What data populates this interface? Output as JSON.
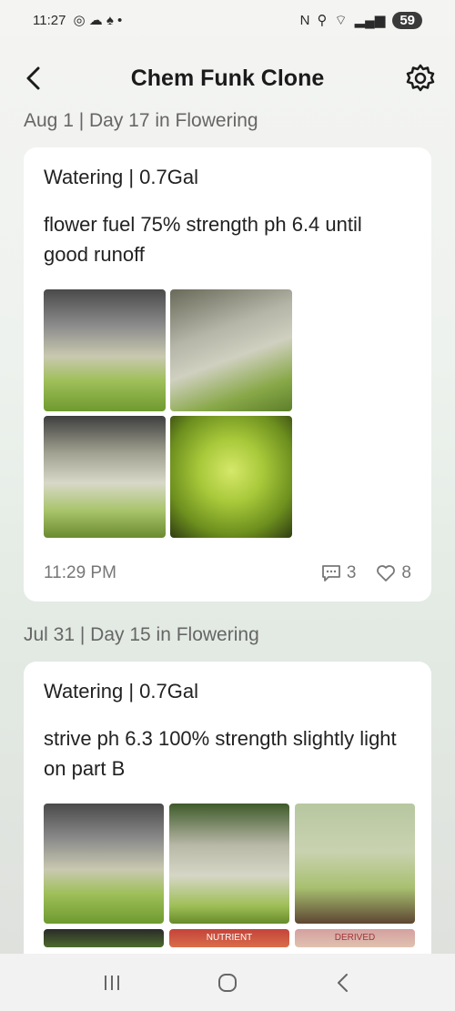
{
  "status_bar": {
    "time": "11:27",
    "battery": "59",
    "signal": "5"
  },
  "header": {
    "title": "Chem Funk Clone",
    "back_icon": "chevron-left-icon",
    "settings_icon": "gear-icon"
  },
  "entries": [
    {
      "date": "Aug 1 | Day 17 in Flowering",
      "title": "Watering | 0.7Gal",
      "text": "flower fuel 75% strength ph 6.4 until good runoff",
      "time": "11:29 PM",
      "comments": "3",
      "likes": "8"
    },
    {
      "date": "Jul 31 | Day 15 in Flowering",
      "title": "Watering | 0.7Gal",
      "text": "strive ph 6.3 100% strength slightly light on part B",
      "partial_label_1": "NUTRIENT",
      "partial_label_2": "DERIVED"
    }
  ],
  "colors": {
    "background": "#eef2ee",
    "card": "#ffffff",
    "text": "#1f1f1f",
    "muted": "#777777"
  }
}
